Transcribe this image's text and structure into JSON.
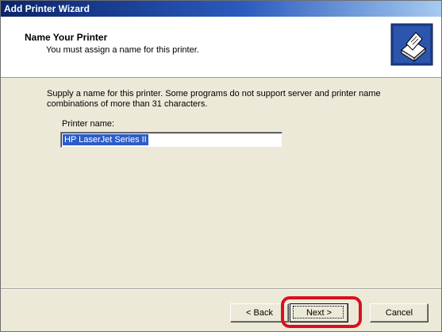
{
  "window": {
    "title": "Add Printer Wizard"
  },
  "header": {
    "title": "Name Your Printer",
    "subtitle": "You must assign a name for this printer.",
    "icon": "printer-icon"
  },
  "body": {
    "description": "Supply a name for this printer. Some programs do not support server and printer name combinations of more than 31 characters.",
    "printer_name_label": "Printer name:",
    "printer_name_value": "HP LaserJet Series II"
  },
  "buttons": {
    "back": "< Back",
    "next": "Next >",
    "cancel": "Cancel"
  },
  "annotation": {
    "highlight_color": "#d8111f",
    "highlighted_item": "next-button"
  }
}
